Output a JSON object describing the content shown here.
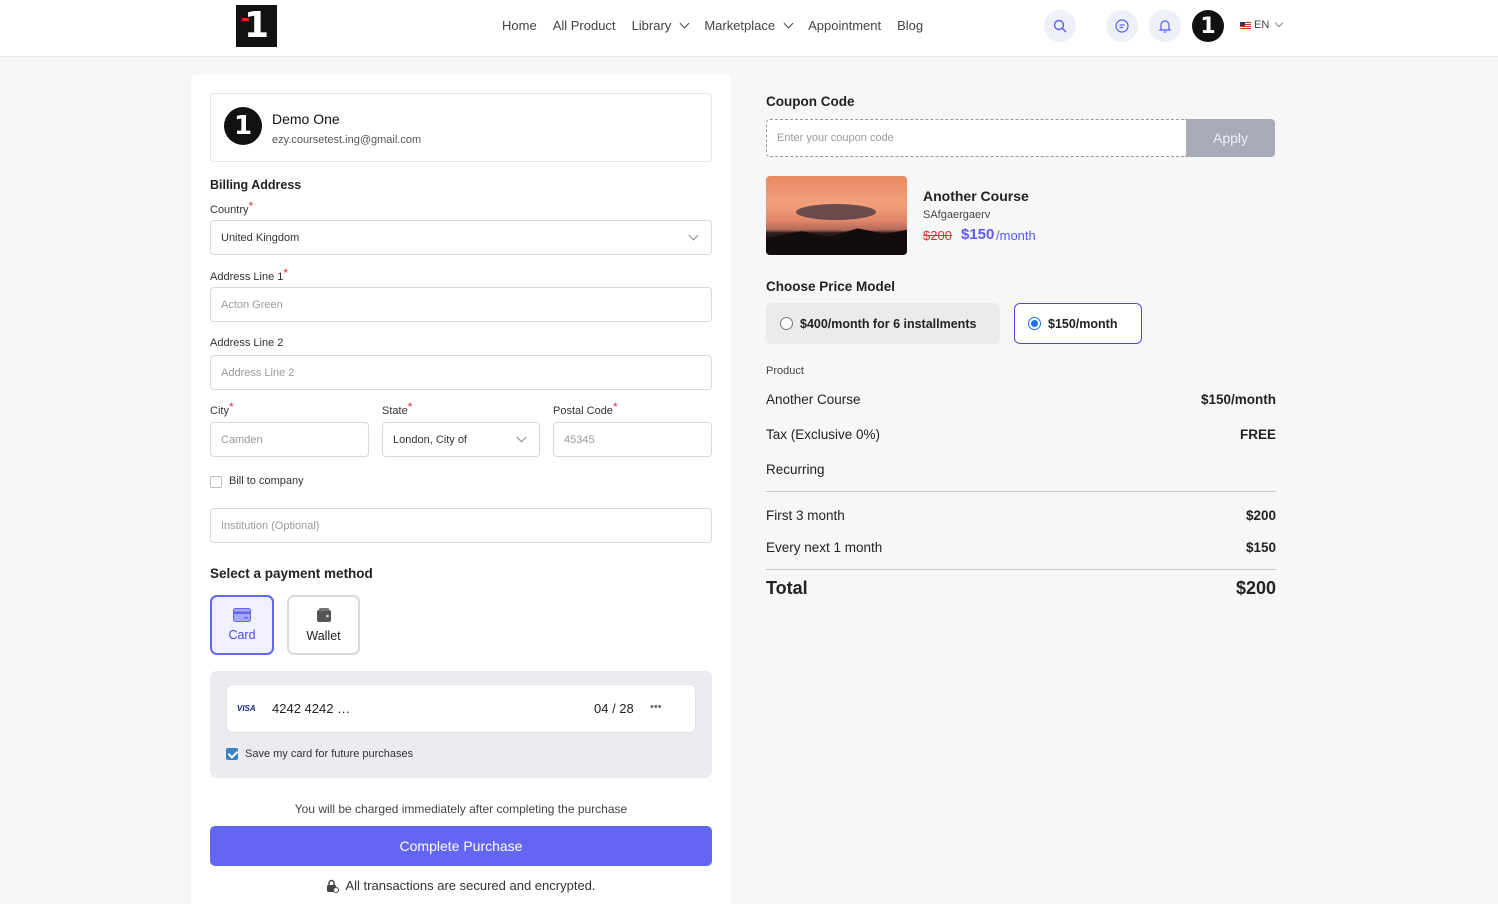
{
  "header": {
    "logo_text": "1",
    "nav": [
      {
        "label": "Home",
        "has_dropdown": false
      },
      {
        "label": "All Product",
        "has_dropdown": false
      },
      {
        "label": "Library",
        "has_dropdown": true
      },
      {
        "label": "Marketplace",
        "has_dropdown": true
      },
      {
        "label": "Appointment",
        "has_dropdown": false
      },
      {
        "label": "Blog",
        "has_dropdown": false
      }
    ],
    "icons": [
      "search-icon",
      "chat-icon",
      "bell-icon"
    ],
    "avatar_text": "1",
    "language": "EN"
  },
  "user": {
    "avatar_text": "1",
    "name": "Demo One",
    "email": "ezy.coursetest.ing@gmail.com"
  },
  "billing": {
    "title": "Billing Address",
    "country_label": "Country",
    "country_value": "United Kingdom",
    "address1_label": "Address Line 1",
    "address1_value": "Acton Green",
    "address2_label": "Address Line 2",
    "address2_placeholder": "Address Line 2",
    "city_label": "City",
    "city_value": "Camden",
    "state_label": "State",
    "state_value": "London, City of",
    "postal_label": "Postal Code",
    "postal_value": "45345",
    "required_mark": "*",
    "bill_company_label": "Bill to company",
    "institution_placeholder": "Institution (Optional)"
  },
  "payment": {
    "title": "Select a payment method",
    "methods": [
      {
        "label": "Card",
        "active": true
      },
      {
        "label": "Wallet",
        "active": false
      }
    ],
    "card_brand": "VISA",
    "card_number": "4242 4242 …",
    "card_expiry": "04 / 28",
    "card_cvc": "•••",
    "save_card_label": "Save my card for future purchases",
    "save_card_checked": true,
    "charge_note": "You will be charged immediately after completing the purchase",
    "submit_label": "Complete Purchase",
    "secure_note": "All transactions are secured and encrypted."
  },
  "coupon": {
    "title": "Coupon Code",
    "placeholder": "Enter your coupon code",
    "apply_label": "Apply"
  },
  "course": {
    "name": "Another Course",
    "subtitle": "SAfgaergaerv",
    "old_price": "$200",
    "new_price": "$150",
    "per": "/month"
  },
  "price_model": {
    "title": "Choose Price Model",
    "options": [
      {
        "label": "$400/month for 6 installments",
        "selected": false
      },
      {
        "label": "$150/month",
        "selected": true
      }
    ]
  },
  "summary": {
    "product_label": "Product",
    "rows": [
      {
        "label": "Another Course",
        "value": "$150/month"
      },
      {
        "label": "Tax (Exclusive 0%)",
        "value": "FREE"
      },
      {
        "label": "Recurring",
        "value": ""
      }
    ],
    "recurring_rows": [
      {
        "label": "First 3 month",
        "value": "$200"
      },
      {
        "label": "Every next 1 month",
        "value": "$150"
      }
    ],
    "total_label": "Total",
    "total_value": "$200"
  },
  "colors": {
    "accent": "#6366f1",
    "price_strike": "#dd3333",
    "apply_button": "#a9acb6"
  }
}
